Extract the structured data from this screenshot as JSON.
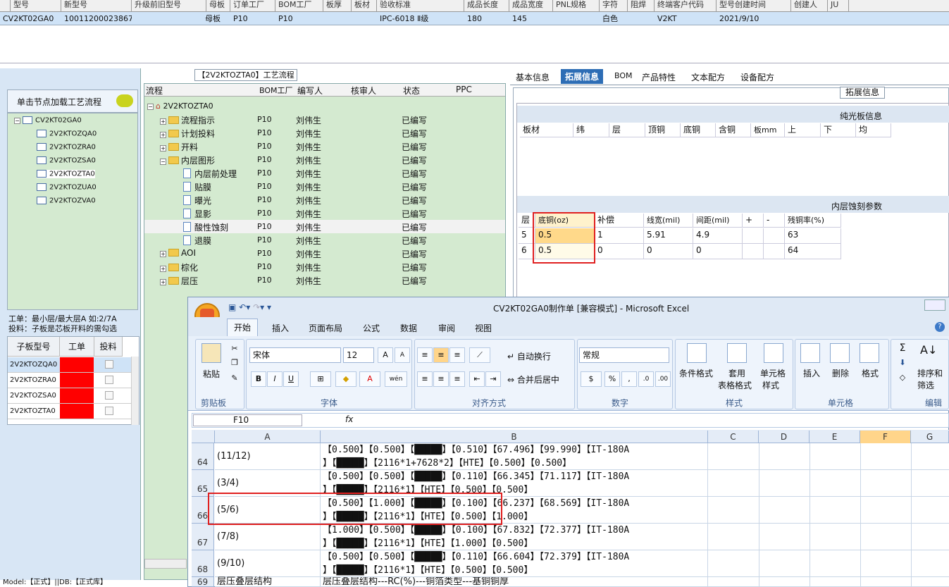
{
  "top_grid": {
    "headers": [
      "型号",
      "新型号",
      "升级前旧型号",
      "母板",
      "订单工厂",
      "BOM工厂",
      "板厚",
      "板材",
      "验收标准",
      "成品长度",
      "成品宽度",
      "PNL规格",
      "字符",
      "阻焊",
      "终端客户代码",
      "型号创建时间",
      "创建人",
      "JU"
    ],
    "row": [
      "CV2KT02GA0",
      "10011200023867",
      "",
      "母板",
      "P10",
      "P10",
      "",
      "",
      "IPC-6018 Ⅱ级",
      "180",
      "145",
      "",
      "白色",
      "",
      "V2KT",
      "2021/9/10",
      "",
      ""
    ]
  },
  "left_panel": {
    "load_label": "单击节点加载工艺流程",
    "tree": [
      "CV2KT02GA0",
      "2V2KTOZQA0",
      "2V2KTOZRA0",
      "2V2KTOZSA0",
      "2V2KTOZTA0",
      "2V2KTOZUA0",
      "2V2KTOZVA0"
    ],
    "note_line1": "工单：最小层/最大层A 如:2/7A",
    "note_line2": "投料：子板是芯板开料的需勾选",
    "subgrid_headers": [
      "子板型号",
      "工单",
      "投料"
    ],
    "subgrid_rows": [
      "2V2KTOZQA0",
      "2V2KTOZRA0",
      "2V2KTOZSA0",
      "2V2KTOZTA0"
    ],
    "status": "Model:【正式】||DB:【正式库】"
  },
  "process": {
    "title": "【2V2KTOZTA0】工艺流程",
    "headers": [
      "流程",
      "BOM工厂",
      "编写人",
      "核审人",
      "状态",
      "PPC"
    ],
    "root": "2V2KTOZTA0",
    "rows": [
      {
        "name": "流程指示",
        "factory": "P10",
        "person": "刘伟生",
        "status": "已编写"
      },
      {
        "name": "计划投料",
        "factory": "P10",
        "person": "刘伟生",
        "status": "已编写"
      },
      {
        "name": "开料",
        "factory": "P10",
        "person": "刘伟生",
        "status": "已编写"
      },
      {
        "name": "内层图形",
        "factory": "P10",
        "person": "刘伟生",
        "status": "已编写"
      },
      {
        "name": "内层前处理",
        "factory": "P10",
        "person": "刘伟生",
        "status": "已编写"
      },
      {
        "name": "贴膜",
        "factory": "P10",
        "person": "刘伟生",
        "status": "已编写"
      },
      {
        "name": "曝光",
        "factory": "P10",
        "person": "刘伟生",
        "status": "已编写"
      },
      {
        "name": "显影",
        "factory": "P10",
        "person": "刘伟生",
        "status": "已编写"
      },
      {
        "name": "酸性蚀刻",
        "factory": "P10",
        "person": "刘伟生",
        "status": "已编写"
      },
      {
        "name": "退膜",
        "factory": "P10",
        "person": "刘伟生",
        "status": "已编写"
      },
      {
        "name": "AOI",
        "factory": "P10",
        "person": "刘伟生",
        "status": "已编写"
      },
      {
        "name": "棕化",
        "factory": "P10",
        "person": "刘伟生",
        "status": "已编写"
      },
      {
        "name": "层压",
        "factory": "P10",
        "person": "刘伟生",
        "status": "已编写"
      }
    ]
  },
  "right_panel": {
    "tabs": [
      "基本信息",
      "拓展信息",
      "BOM",
      "产品特性",
      "文本配方",
      "设备配方"
    ],
    "box_label": "拓展信息",
    "plain_band": "纯光板信息",
    "plain_headers": [
      "板材",
      "纬",
      "层",
      "顶铜",
      "底铜",
      "含铜",
      "板mm",
      "上",
      "下",
      "均"
    ],
    "etch_band": "内层蚀刻参数",
    "etch_headers": [
      "层",
      "底铜(oz)",
      "补偿",
      "线宽(mil)",
      "间距(mil)",
      "+",
      "-",
      "残铜率(%)"
    ],
    "etch_rows": [
      [
        "5",
        "0.5",
        "1",
        "5.91",
        "4.9",
        "",
        "",
        "63"
      ],
      [
        "6",
        "0.5",
        "0",
        "0",
        "0",
        "",
        "",
        "64"
      ]
    ]
  },
  "excel": {
    "title": "CV2KT02GA0制作单 [兼容模式] - Microsoft Excel",
    "tabs": [
      "开始",
      "插入",
      "页面布局",
      "公式",
      "数据",
      "审阅",
      "视图"
    ],
    "font_name": "宋体",
    "font_size": "12",
    "number_format": "常规",
    "labels": {
      "paste": "粘贴",
      "clipboard": "剪贴板",
      "font": "字体",
      "align": "对齐方式",
      "number": "数字",
      "styles": "样式",
      "cells": "单元格",
      "edit": "编辑",
      "wrap": "自动换行",
      "merge": "合并后居中",
      "cond": "条件格式",
      "table1": "套用",
      "table2": "表格格式",
      "cell1": "单元格",
      "cell2": "样式",
      "insert": "插入",
      "delete": "删除",
      "format": "格式",
      "sort1": "排序和",
      "sort2": "筛选"
    },
    "namebox": "F10",
    "fx": "fx",
    "columns": [
      "A",
      "B",
      "C",
      "D",
      "E",
      "F",
      "G"
    ],
    "rows": [
      {
        "num": "64",
        "a": "(11/12)",
        "b1": "【0.500】【0.500】【█████】【0.510】【67.496】【99.990】【IT-180A",
        "b2": "】【█████】【2116*1+7628*2】【HTE】【0.500】【0.500】"
      },
      {
        "num": "65",
        "a": "(3/4)",
        "b1": "【0.500】【0.500】【█████】【0.110】【66.345】【71.117】【IT-180A",
        "b2": "】【█████】【2116*1】【HTE】【0.500】【0.500】"
      },
      {
        "num": "66",
        "a": "(5/6)",
        "b1": "【0.500】【1.000】【█████】【0.100】【66.237】【68.569】【IT-180A",
        "b2": "】【█████】【2116*1】【HTE】【0.500】【1.000】"
      },
      {
        "num": "67",
        "a": "(7/8)",
        "b1": "【1.000】【0.500】【█████】【0.100】【67.832】【72.377】【IT-180A",
        "b2": "】【█████】【2116*1】【HTE】【1.000】【0.500】"
      },
      {
        "num": "68",
        "a": "(9/10)",
        "b1": "【0.500】【0.500】【█████】【0.110】【66.604】【72.379】【IT-180A",
        "b2": "】【█████】【2116*1】【HTE】【0.500】【0.500】"
      },
      {
        "num": "69",
        "a": "层压叠层结构",
        "b1": "层压叠层结构---RC(%)---铜箔类型---基铜铜厚",
        "b2": ""
      }
    ]
  }
}
